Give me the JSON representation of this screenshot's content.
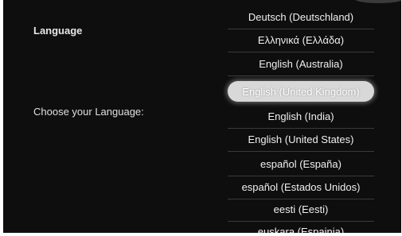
{
  "heading": "Language",
  "prompt": "Choose your Language:",
  "languages": [
    "Deutsch (Deutschland)",
    "Ελληνικά (Ελλάδα)",
    "English (Australia)",
    "English (United Kingdom)",
    "English (India)",
    "English (United States)",
    "español (España)",
    "español (Estados Unidos)",
    "eesti (Eesti)",
    "euskara (Espainia)"
  ],
  "selected": "English (United Kingdom)"
}
